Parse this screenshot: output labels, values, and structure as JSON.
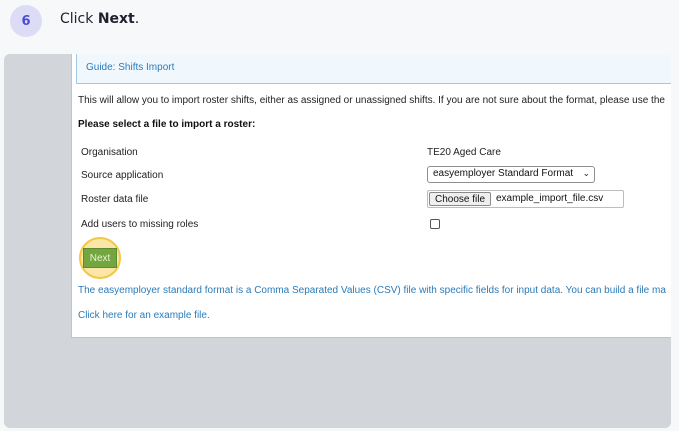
{
  "step": {
    "number": "6",
    "prefix": "Click ",
    "target": "Next",
    "suffix": "."
  },
  "guide": {
    "link": "Guide: Shifts Import"
  },
  "intro": "This will allow you to import roster shifts, either as assigned or unassigned shifts. If you are not sure about the format, please use the",
  "subheading": "Please select a file to import a roster:",
  "form": {
    "organisation_label": "Organisation",
    "organisation_value": "TE20 Aged Care",
    "source_label": "Source application",
    "source_value": "easyemployer Standard Format",
    "roster_file_label": "Roster data file",
    "choose_file_label": "Choose file",
    "file_name": "example_import_file.csv",
    "add_users_label": "Add users to missing roles",
    "add_users_checked": false
  },
  "next_label": "Next",
  "description": "The easyemployer standard format is a Comma Separated Values (CSV) file with specific fields for input data. You can build a file ma",
  "example_link": "Click here for an example file.",
  "colors": {
    "badge_bg": "#dcdcf7",
    "badge_text": "#4b4ccf",
    "next_button": "#74a63f",
    "highlight": "#f2c744",
    "link": "#2b7bb9"
  }
}
